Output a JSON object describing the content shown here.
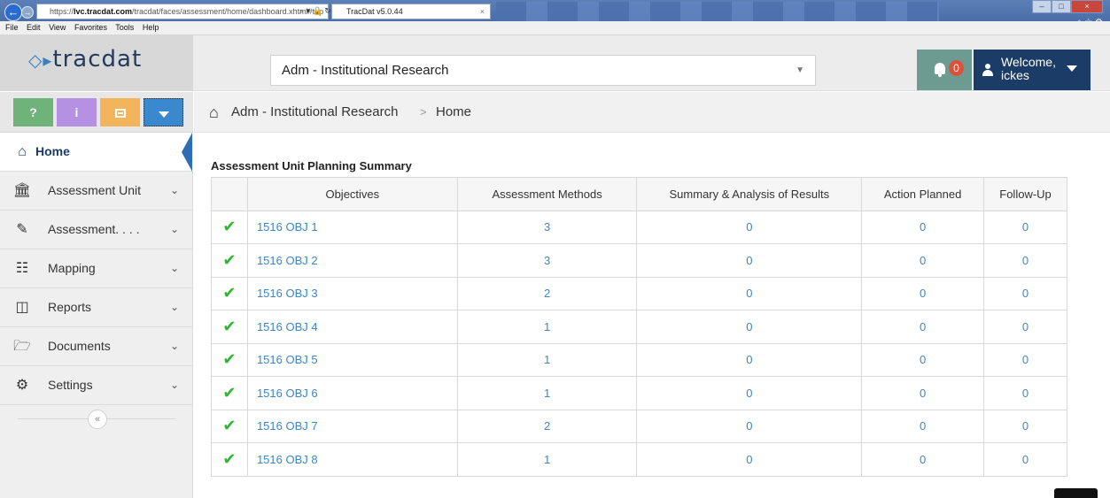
{
  "browser": {
    "url_prefix": "https://",
    "url_domain": "lvc.tracdat.com",
    "url_path": "/tracdat/faces/assessment/home/dashboard.xhtml#top",
    "tab_title": "TracDat v5.0.44",
    "menu": [
      "File",
      "Edit",
      "View",
      "Favorites",
      "Tools",
      "Help"
    ]
  },
  "header": {
    "logo_text": "tracdat",
    "unit_selected": "Adm - Institutional Research",
    "notification_count": "0",
    "welcome_line1": "Welcome,",
    "welcome_line2": "ickes"
  },
  "quick_buttons": {
    "help": "?",
    "info": "i"
  },
  "sidebar": {
    "items": [
      {
        "label": "Home",
        "icon": "home-icon",
        "active": true
      },
      {
        "label": "Assessment Unit",
        "icon": "institution-icon"
      },
      {
        "label": "Assessment. . . .",
        "icon": "pencil-icon"
      },
      {
        "label": "Mapping",
        "icon": "sitemap-icon"
      },
      {
        "label": "Reports",
        "icon": "columns-icon"
      },
      {
        "label": "Documents",
        "icon": "folder-icon"
      },
      {
        "label": "Settings",
        "icon": "gear-icon"
      }
    ],
    "collapse_label": "«"
  },
  "breadcrumb": {
    "unit": "Adm - Institutional Research",
    "separator": ">",
    "current": "Home"
  },
  "summary": {
    "title": "Assessment Unit Planning Summary",
    "columns": [
      "Objectives",
      "Assessment Methods",
      "Summary & Analysis of Results",
      "Action Planned",
      "Follow-Up"
    ],
    "rows": [
      {
        "objective": "1516 OBJ 1",
        "methods": "3",
        "results": "0",
        "action": "0",
        "followup": "0"
      },
      {
        "objective": "1516 OBJ 2",
        "methods": "3",
        "results": "0",
        "action": "0",
        "followup": "0"
      },
      {
        "objective": "1516 OBJ 3",
        "methods": "2",
        "results": "0",
        "action": "0",
        "followup": "0"
      },
      {
        "objective": "1516 OBJ 4",
        "methods": "1",
        "results": "0",
        "action": "0",
        "followup": "0"
      },
      {
        "objective": "1516 OBJ 5",
        "methods": "1",
        "results": "0",
        "action": "0",
        "followup": "0"
      },
      {
        "objective": "1516 OBJ 6",
        "methods": "1",
        "results": "0",
        "action": "0",
        "followup": "0"
      },
      {
        "objective": "1516 OBJ 7",
        "methods": "2",
        "results": "0",
        "action": "0",
        "followup": "0"
      },
      {
        "objective": "1516 OBJ 8",
        "methods": "1",
        "results": "0",
        "action": "0",
        "followup": "0"
      }
    ]
  },
  "colors": {
    "brand_navy": "#1b3c67",
    "link_blue": "#3a86c9",
    "check_green": "#2eb82e",
    "bell_teal": "#6d9b91",
    "badge_red": "#d9523b"
  }
}
